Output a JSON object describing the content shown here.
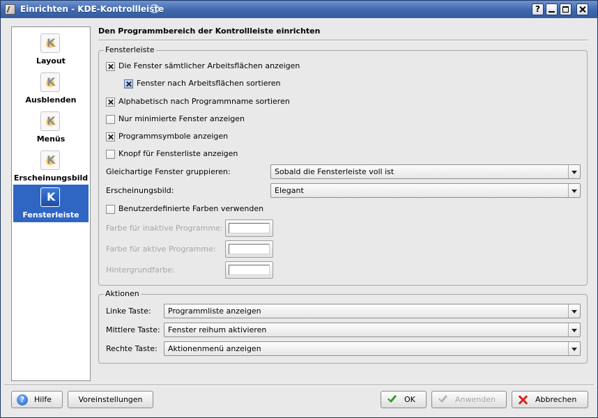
{
  "window": {
    "title": "Einrichten - KDE-Kontrollleiste",
    "buttons": {
      "help": "?"
    }
  },
  "sidebar": {
    "items": [
      {
        "label": "Layout",
        "icon": "kde-config-icon",
        "active": false
      },
      {
        "label": "Ausblenden",
        "icon": "kde-config-icon",
        "active": false
      },
      {
        "label": "Menüs",
        "icon": "kde-config-icon",
        "active": false
      },
      {
        "label": "Erscheinungsbild",
        "icon": "kde-config-icon",
        "active": false
      },
      {
        "label": "Fensterleiste",
        "icon": "kde-taskbar-icon",
        "active": true
      }
    ]
  },
  "main": {
    "heading": "Den Programmbereich der Kontrollleiste einrichten",
    "taskbar_group": {
      "title": "Fensterleiste",
      "checkboxes": [
        {
          "label": "Die Fenster sämtlicher Arbeitsflächen anzeigen",
          "checked": true
        },
        {
          "label": "Fenster nach Arbeitsflächen sortieren",
          "checked": true
        },
        {
          "label": "Alphabetisch nach Programmname sortieren",
          "checked": true
        },
        {
          "label": "Nur minimierte Fenster anzeigen",
          "checked": false
        },
        {
          "label": "Programmsymbole anzeigen",
          "checked": true
        },
        {
          "label": "Knopf für Fensterliste anzeigen",
          "checked": false
        }
      ],
      "group_label": "Gleichartige Fenster gruppieren:",
      "group_value": "Sobald die Fensterleiste voll ist",
      "appearance_label": "Erscheinungsbild:",
      "appearance_value": "Elegant",
      "custom_colors": {
        "label": "Benutzerdefinierte Farben verwenden",
        "checked": false
      },
      "colors": [
        {
          "label": "Farbe für inaktive Programme:"
        },
        {
          "label": "Farbe für aktive Programme:"
        },
        {
          "label": "Hintergrundfarbe:"
        }
      ]
    },
    "actions_group": {
      "title": "Aktionen",
      "rows": [
        {
          "label": "Linke Taste:",
          "value": "Programmliste anzeigen"
        },
        {
          "label": "Mittlere Taste:",
          "value": "Fenster reihum aktivieren"
        },
        {
          "label": "Rechte Taste:",
          "value": "Aktionenmenü anzeigen"
        }
      ]
    }
  },
  "footer": {
    "help": "Hilfe",
    "defaults": "Voreinstellungen",
    "ok": "OK",
    "apply": "Anwenden",
    "cancel": "Abbrechen"
  },
  "colors": {
    "titlebar": "#3f67ad",
    "selection": "#2f66c4",
    "window_bg": "#e9e9e9"
  }
}
